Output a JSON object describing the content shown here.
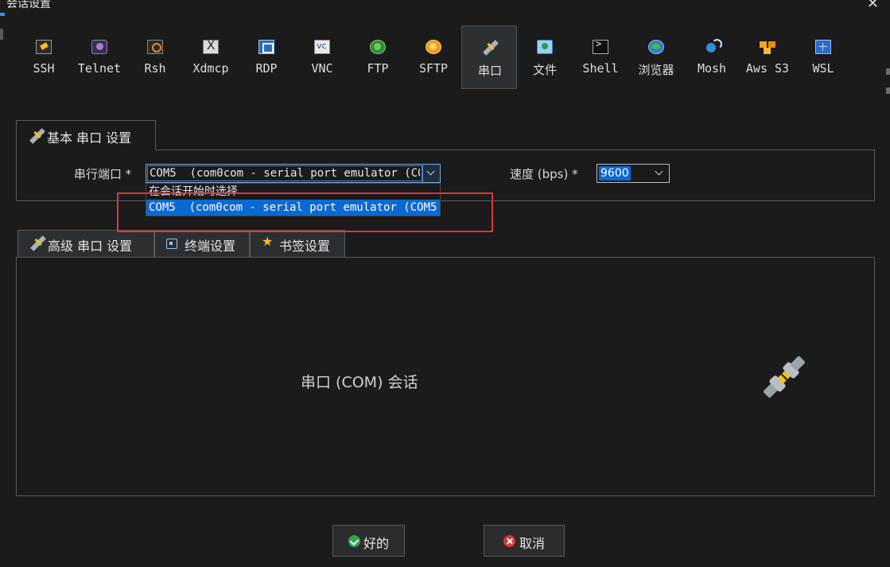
{
  "window": {
    "title": "会话设置"
  },
  "protocols": [
    {
      "label": "SSH",
      "icon": "key-icon"
    },
    {
      "label": "Telnet",
      "icon": "telnet-icon"
    },
    {
      "label": "Rsh",
      "icon": "rsh-icon"
    },
    {
      "label": "Xdmcp",
      "icon": "xdmcp-icon"
    },
    {
      "label": "RDP",
      "icon": "rdp-icon"
    },
    {
      "label": "VNC",
      "icon": "vnc-icon"
    },
    {
      "label": "FTP",
      "icon": "ftp-globe-icon"
    },
    {
      "label": "SFTP",
      "icon": "sftp-icon"
    },
    {
      "label": "串口",
      "icon": "serial-plug-icon",
      "active": true
    },
    {
      "label": "文件",
      "icon": "file-icon"
    },
    {
      "label": "Shell",
      "icon": "shell-icon"
    },
    {
      "label": "浏览器",
      "icon": "browser-icon"
    },
    {
      "label": "Mosh",
      "icon": "mosh-icon"
    },
    {
      "label": "Aws S3",
      "icon": "aws-s3-icon"
    },
    {
      "label": "WSL",
      "icon": "wsl-icon"
    }
  ],
  "basic_tab": {
    "label": "基本 串口 设置"
  },
  "serial_port": {
    "label": "串行端口 *",
    "value": "COM5  (com0com - serial port emulator (COM5",
    "options": [
      "在会话开始时选择",
      "COM5  (com0com - serial port emulator (COM5"
    ],
    "selected_index": 1
  },
  "speed": {
    "label": "速度 (bps) *",
    "value": "9600"
  },
  "advanced_tabs": [
    {
      "label": "高级 串口 设置",
      "icon": "serial-plug-icon"
    },
    {
      "label": "终端设置",
      "icon": "terminal-icon"
    },
    {
      "label": "书签设置",
      "icon": "star-icon"
    }
  ],
  "session_caption": "串口 (COM) 会话",
  "buttons": {
    "ok": "好的",
    "cancel": "取消"
  },
  "colors": {
    "accent": "#0c69d3",
    "highlight_box": "#e0343f",
    "active_tab_bg": "#2c3033"
  }
}
